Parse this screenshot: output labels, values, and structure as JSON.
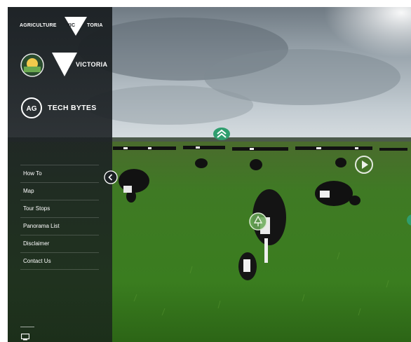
{
  "branding": {
    "agriculture_victoria": {
      "left": "AGRICULTURE",
      "mid": "VIC",
      "right": "TORIA"
    },
    "victoria_government": {
      "text": "VICTORIA"
    },
    "ag_tech_bytes": {
      "badge": "AG",
      "text": "TECH BYTES"
    }
  },
  "menu": {
    "items": [
      {
        "label": "How To"
      },
      {
        "label": "Map"
      },
      {
        "label": "Tour Stops"
      },
      {
        "label": "Panorama List"
      },
      {
        "label": "Disclaimer"
      },
      {
        "label": "Contact Us"
      }
    ]
  },
  "icons": {
    "collapse": "chevron-left-icon",
    "up_hotspot": "double-chevron-up-icon",
    "play_hotspot": "play-icon",
    "info_hotspot": "info-hotspot-icon",
    "screen": "monitor-icon"
  },
  "colors": {
    "sidebar": "#1c2124",
    "hotspot_green": "#2f9e6e",
    "play_overlay": "#ffffff"
  }
}
